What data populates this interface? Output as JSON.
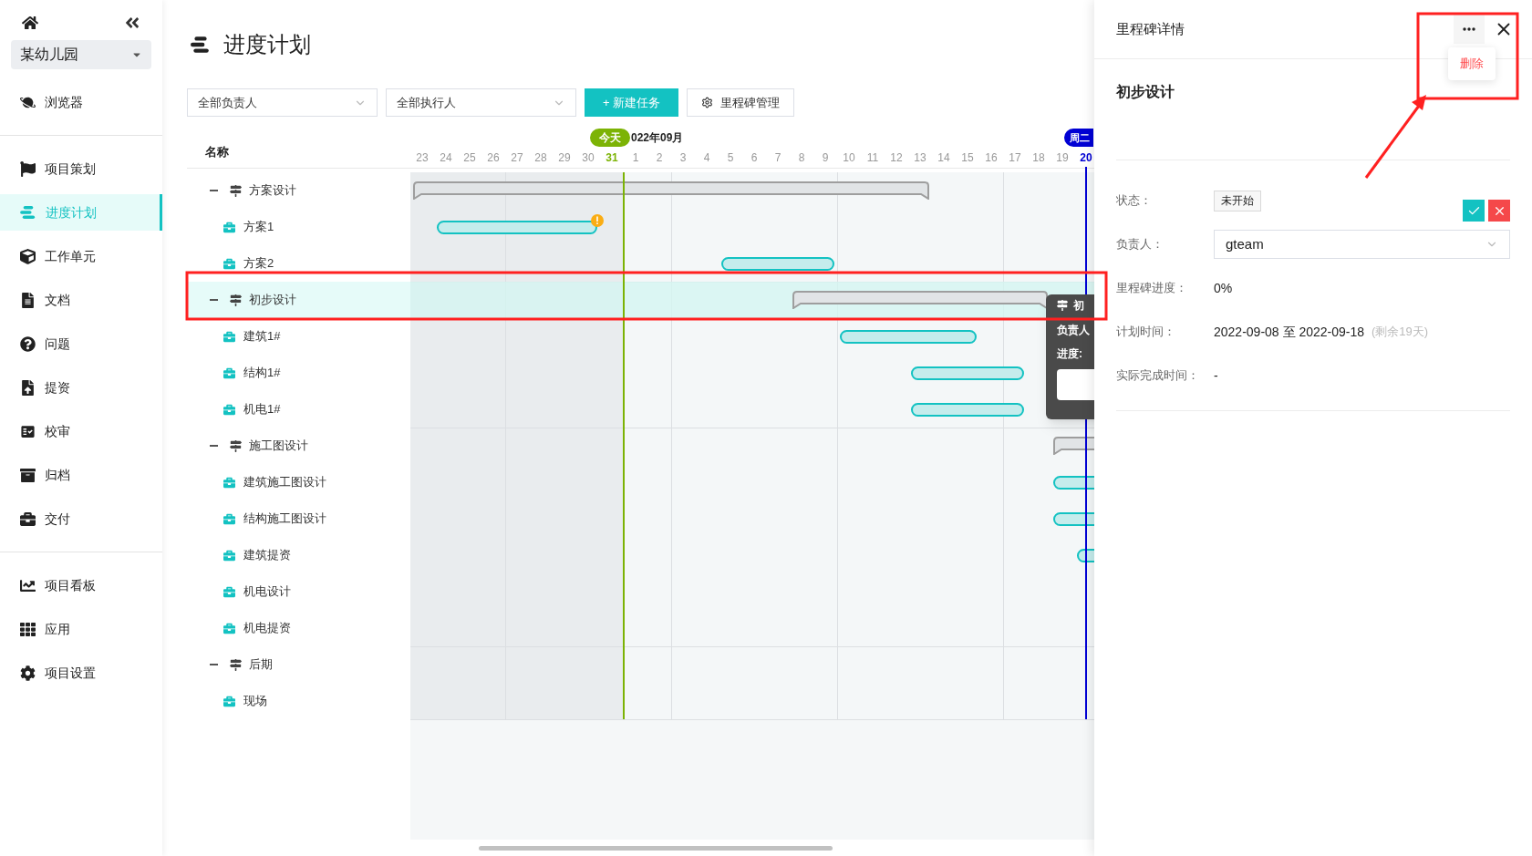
{
  "sidebar": {
    "project": "某幼儿园",
    "sections": [
      [
        {
          "label": "浏览器",
          "selected": false
        }
      ],
      [
        {
          "label": "项目策划",
          "selected": false
        },
        {
          "label": "进度计划",
          "selected": true
        },
        {
          "label": "工作单元",
          "selected": false
        },
        {
          "label": "文档",
          "selected": false
        },
        {
          "label": "问题",
          "selected": false
        },
        {
          "label": "提资",
          "selected": false
        },
        {
          "label": "校审",
          "selected": false
        },
        {
          "label": "归档",
          "selected": false
        },
        {
          "label": "交付",
          "selected": false
        }
      ],
      [
        {
          "label": "项目看板",
          "selected": false
        },
        {
          "label": "应用",
          "selected": false
        },
        {
          "label": "项目设置",
          "selected": false
        }
      ]
    ]
  },
  "page": {
    "title": "进度计划"
  },
  "filters": [
    {
      "value": "全部负责人"
    },
    {
      "value": "全部执行人"
    }
  ],
  "buttons": [
    {
      "label": "+ 新建任务",
      "kind": "primary"
    },
    {
      "label": "里程碑管理",
      "kind": "settings"
    }
  ],
  "gantt": {
    "name_header": "名称",
    "today_badge": "今天",
    "month": "022年09月",
    "marker_badge": "周二",
    "days": [
      {
        "label": "23",
        "kind": "normal"
      },
      {
        "label": "24",
        "kind": "normal"
      },
      {
        "label": "25",
        "kind": "normal"
      },
      {
        "label": "26",
        "kind": "normal"
      },
      {
        "label": "27",
        "kind": "normal"
      },
      {
        "label": "28",
        "kind": "normal"
      },
      {
        "label": "29",
        "kind": "normal"
      },
      {
        "label": "30",
        "kind": "normal"
      },
      {
        "label": "31",
        "kind": "today"
      },
      {
        "label": "1",
        "kind": "normal"
      },
      {
        "label": "2",
        "kind": "normal"
      },
      {
        "label": "3",
        "kind": "normal"
      },
      {
        "label": "4",
        "kind": "normal"
      },
      {
        "label": "5",
        "kind": "normal"
      },
      {
        "label": "6",
        "kind": "normal"
      },
      {
        "label": "7",
        "kind": "normal"
      },
      {
        "label": "8",
        "kind": "normal"
      },
      {
        "label": "9",
        "kind": "normal"
      },
      {
        "label": "10",
        "kind": "normal"
      },
      {
        "label": "11",
        "kind": "normal"
      },
      {
        "label": "12",
        "kind": "normal"
      },
      {
        "label": "13",
        "kind": "normal"
      },
      {
        "label": "14",
        "kind": "normal"
      },
      {
        "label": "15",
        "kind": "normal"
      },
      {
        "label": "16",
        "kind": "normal"
      },
      {
        "label": "17",
        "kind": "normal"
      },
      {
        "label": "18",
        "kind": "normal"
      },
      {
        "label": "19",
        "kind": "normal"
      },
      {
        "label": "20",
        "kind": "marker"
      }
    ],
    "tasks": [
      {
        "name": "方案设计",
        "kind": "group",
        "expanded": true,
        "selected": false,
        "children": [
          {
            "name": "方案1",
            "kind": "task",
            "selected": false,
            "warning": true
          },
          {
            "name": "方案2",
            "kind": "task",
            "selected": false,
            "warning": false
          }
        ]
      },
      {
        "name": "初步设计",
        "kind": "group",
        "expanded": true,
        "selected": true,
        "children": [
          {
            "name": "建筑1#",
            "kind": "task",
            "selected": false,
            "warning": false
          },
          {
            "name": "结构1#",
            "kind": "task",
            "selected": false,
            "warning": false
          },
          {
            "name": "机电1#",
            "kind": "task",
            "selected": false,
            "warning": false
          }
        ]
      },
      {
        "name": "施工图设计",
        "kind": "group",
        "expanded": true,
        "selected": false,
        "children": [
          {
            "name": "建筑施工图设计",
            "kind": "task",
            "selected": false,
            "warning": false
          },
          {
            "name": "结构施工图设计",
            "kind": "task",
            "selected": false,
            "warning": false
          },
          {
            "name": "建筑提资",
            "kind": "task",
            "selected": false,
            "warning": false
          },
          {
            "name": "机电设计",
            "kind": "task",
            "selected": false,
            "warning": false
          },
          {
            "name": "机电提资",
            "kind": "task",
            "selected": false,
            "warning": false
          }
        ]
      },
      {
        "name": "后期",
        "kind": "group",
        "expanded": true,
        "selected": false,
        "children": [
          {
            "name": "现场",
            "kind": "task",
            "selected": false,
            "warning": false
          }
        ]
      }
    ],
    "tooltip": {
      "title": "初",
      "lines": [
        "负责人",
        "进度:"
      ]
    }
  },
  "panel": {
    "title": "里程碑详情",
    "menu": [
      {
        "label": "删除",
        "kind": "danger"
      }
    ],
    "name": "初步设计",
    "fields": [
      {
        "label": "状态：",
        "kind": "tag",
        "value": "未开始"
      },
      {
        "label": "负责人：",
        "kind": "select",
        "value": "gteam"
      },
      {
        "label": "里程碑进度：",
        "kind": "text",
        "value": "0%"
      },
      {
        "label": "计划时间：",
        "kind": "text",
        "value": "2022-09-08 至 2022-09-18",
        "note": "(剩余19天)"
      },
      {
        "label": "实际完成时间：",
        "kind": "text",
        "value": "-"
      }
    ]
  }
}
